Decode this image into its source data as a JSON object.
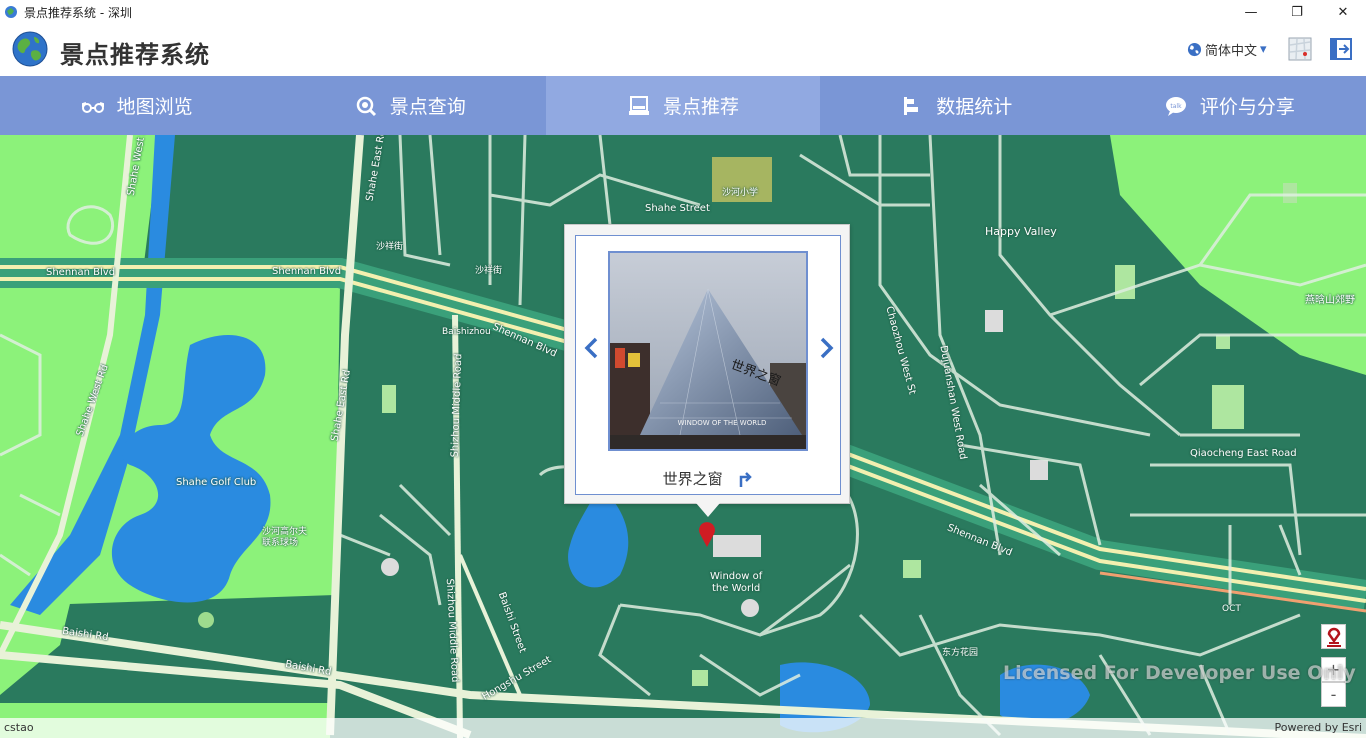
{
  "window": {
    "title": "景点推荐系统 - 深圳",
    "minimize_glyph": "—",
    "restore_glyph": "❐",
    "close_glyph": "✕"
  },
  "header": {
    "app_title": "景点推荐系统",
    "language": "简体中文",
    "language_caret": "▾"
  },
  "nav": {
    "items": [
      {
        "label": "地图浏览",
        "icon": "glasses-icon"
      },
      {
        "label": "景点查询",
        "icon": "search-icon"
      },
      {
        "label": "景点推荐",
        "icon": "monitor-icon"
      },
      {
        "label": "数据统计",
        "icon": "bar-chart-icon"
      },
      {
        "label": "评价与分享",
        "icon": "chat-bubble-icon"
      }
    ],
    "active_index": 2
  },
  "popup": {
    "attraction_name": "世界之窗",
    "prev_glyph": "‹",
    "next_glyph": "›",
    "photo_caption": "WINDOW OF THE WORLD"
  },
  "map": {
    "labels": {
      "shahe_west_1": "Shahe West Rd",
      "shahe_east_1": "Shahe East Rd",
      "shahe_street": "Shahe Street",
      "shahe_school": "沙河小学",
      "happy_valley": "Happy Valley",
      "shennan_1": "Shennan Blvd",
      "shennan_2": "Shennan Blvd",
      "shennan_3": "Shennan Blvd",
      "shennan_4": "Shennan Blvd",
      "shaxijie_1": "沙祥街",
      "shaxijie_2": "沙祥街",
      "baishizhou": "Baishizhou",
      "chaozhou_west": "Chaozhou West St",
      "dujuanshan": "Dujuanshan West Road",
      "yanhanshan": "燕晗山郊野",
      "shahe_west_2": "Shahe West Rd",
      "shahe_east_2": "Shahe East Rd",
      "shizhou_middle_1": "Shizhou Middle Road",
      "qiaocheng_east": "Qiaocheng East Road",
      "golf_club": "Shahe Golf Club",
      "golf_cn": "沙河高尔夫\n联系球场",
      "window_world": "Window of\nthe World",
      "oct": "OCT",
      "baishi_1": "Baishi Rd",
      "baishi_2": "Baishi Rd",
      "shizhou_middle_2": "Shizhou Middle Road",
      "baishi_street": "Baishi Street",
      "hongshu_street": "Hongshu Street",
      "dongfang_garden": "东方花园"
    },
    "watermark": "Licensed For Developer Use Only",
    "attribution_left": "cstao",
    "attribution_right": "Powered by Esri",
    "zoom_in": "+",
    "zoom_out": "-"
  },
  "colors": {
    "nav_bg": "#7a96d6",
    "nav_active": "#91a9e1",
    "map_bg": "#2a7a5e",
    "park_green": "#8cf27a",
    "water_blue": "#2a8be0",
    "road_light": "#e8f2d8",
    "highway_yellow": "#f3f0b0"
  }
}
